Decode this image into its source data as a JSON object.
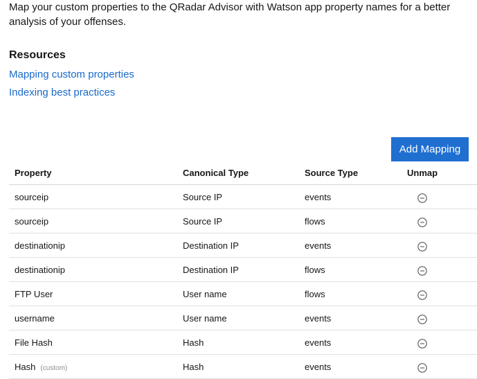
{
  "intro": {
    "text": "Map your custom properties to the QRadar Advisor with Watson app property names for a better analysis of your offenses."
  },
  "resources": {
    "heading": "Resources",
    "links": [
      {
        "label": "Mapping custom properties"
      },
      {
        "label": "Indexing best practices"
      }
    ]
  },
  "actions": {
    "add_mapping_label": "Add Mapping"
  },
  "table": {
    "headers": {
      "property": "Property",
      "canonical_type": "Canonical Type",
      "source_type": "Source Type",
      "unmap": "Unmap"
    },
    "rows": [
      {
        "property": "sourceip",
        "tag": "",
        "canonical_type": "Source IP",
        "source_type": "events"
      },
      {
        "property": "sourceip",
        "tag": "",
        "canonical_type": "Source IP",
        "source_type": "flows"
      },
      {
        "property": "destinationip",
        "tag": "",
        "canonical_type": "Destination IP",
        "source_type": "events"
      },
      {
        "property": "destinationip",
        "tag": "",
        "canonical_type": "Destination IP",
        "source_type": "flows"
      },
      {
        "property": "FTP User",
        "tag": "",
        "canonical_type": "User name",
        "source_type": "flows"
      },
      {
        "property": "username",
        "tag": "",
        "canonical_type": "User name",
        "source_type": "events"
      },
      {
        "property": "File Hash",
        "tag": "",
        "canonical_type": "Hash",
        "source_type": "events"
      },
      {
        "property": "Hash",
        "tag": "(custom)",
        "canonical_type": "Hash",
        "source_type": "events"
      }
    ]
  },
  "icons": {
    "unmap": "minus-circle-icon"
  },
  "colors": {
    "link": "#1a6ac9",
    "primary_button": "#1f6fd1"
  }
}
